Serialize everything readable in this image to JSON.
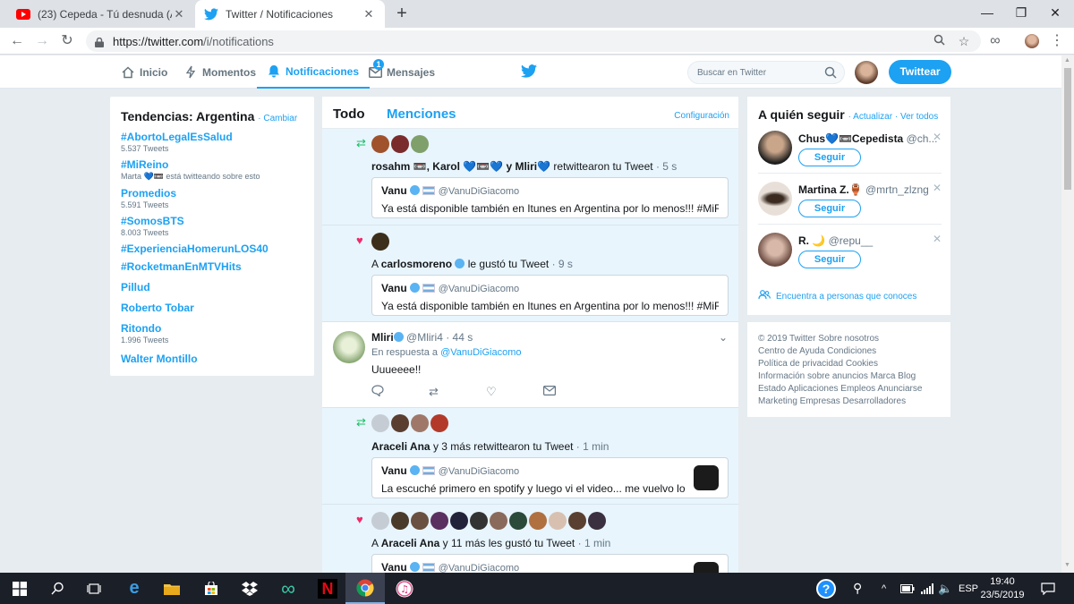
{
  "browser": {
    "tabs": [
      {
        "title": "(23) Cepeda - Tú desnuda (Acústi",
        "icon": "youtube-icon"
      },
      {
        "title": "Twitter / Notificaciones",
        "icon": "twitter-bird-icon"
      }
    ],
    "url_host": "https://twitter.com",
    "url_path": "/i/notifications"
  },
  "nav": {
    "home": "Inicio",
    "moments": "Momentos",
    "notifications": "Notificaciones",
    "messages": "Mensajes",
    "messages_badge": "1",
    "search_placeholder": "Buscar en Twitter",
    "tweet_button": "Twittear"
  },
  "trends": {
    "title": "Tendencias: Argentina",
    "change": "· Cambiar",
    "items": [
      {
        "name": "#AbortoLegalEsSalud",
        "meta": "5.537 Tweets"
      },
      {
        "name": "#MiReino",
        "meta": "Marta 💙📼 está twitteando sobre esto"
      },
      {
        "name": "Promedios",
        "meta": "5.591 Tweets"
      },
      {
        "name": "#SomosBTS",
        "meta": "8.003 Tweets"
      },
      {
        "name": "#ExperienciaHomerunLOS40",
        "meta": ""
      },
      {
        "name": "#RocketmanEnMTVHits",
        "meta": ""
      },
      {
        "name": "Pillud",
        "meta": ""
      },
      {
        "name": "Roberto Tobar",
        "meta": ""
      },
      {
        "name": "Ritondo",
        "meta": "1.996 Tweets"
      },
      {
        "name": "Walter Montillo",
        "meta": ""
      }
    ]
  },
  "stream": {
    "tab_all": "Todo",
    "tab_mentions": "Menciones",
    "settings": "Configuración",
    "n1": {
      "users": "rosahm 📼, Karol 💙📼💙 y Mliri💙",
      "action": "retwittearon tu Tweet",
      "time": "· 5 s",
      "q_name": "Vanu",
      "q_handle": "@VanuDiGiacomo",
      "q_text": "Ya está disponible también en Itunes en Argentina por lo menos!!! #MiReino"
    },
    "n2": {
      "prefix": "A",
      "user": "carlosmoreno",
      "action": "le gustó tu Tweet",
      "time": "· 9 s",
      "q_name": "Vanu",
      "q_handle": "@VanuDiGiacomo",
      "q_text": "Ya está disponible también en Itunes en Argentina por lo menos!!! #MiReino"
    },
    "tweet": {
      "name": "Mliri",
      "handle": "@Mliri4",
      "time": "· 44 s",
      "reply_prefix": "En respuesta a",
      "reply_to": "@VanuDiGiacomo",
      "text": "Uuueeee!!"
    },
    "n3": {
      "user": "Araceli Ana",
      "action": "y 3 más retwittearon tu Tweet",
      "time": "· 1 min",
      "q_name": "Vanu",
      "q_handle": "@VanuDiGiacomo",
      "q_text": "La escuché primero en spotify y luego vi el video... me vuelvo loca. A..."
    },
    "n4": {
      "prefix": "A",
      "user": "Araceli Ana",
      "action": "y 11 más les gustó tu Tweet",
      "time": "· 1 min",
      "q_name": "Vanu",
      "q_handle": "@VanuDiGiacomo"
    }
  },
  "who_to_follow": {
    "title": "A quién seguir",
    "links": "· Actualizar · Ver todos",
    "follow_label": "Seguir",
    "users": [
      {
        "name": "Chus💙📼Cepedista",
        "handle": "@ch..."
      },
      {
        "name": "Martina Z.🏺",
        "handle": "@mrtn_zlzng"
      },
      {
        "name": "R. 🌙",
        "handle": "@repu__"
      }
    ],
    "find_friends": "Encuentra a personas que conoces"
  },
  "footer": {
    "lines": [
      "© 2019 Twitter  Sobre nosotros",
      "Centro de Ayuda  Condiciones",
      "Política de privacidad  Cookies",
      "Información sobre anuncios  Marca  Blog",
      "Estado  Aplicaciones  Empleos  Anunciarse",
      "Marketing  Empresas  Desarrolladores"
    ]
  },
  "taskbar": {
    "lang": "ESP",
    "time": "19:40",
    "date": "23/5/2019"
  },
  "colors": {
    "twitter_blue": "#1da1f2",
    "like_red": "#ed2b6a",
    "retweet_green": "#17bf63",
    "notif_bg": "#e8f5fd"
  }
}
